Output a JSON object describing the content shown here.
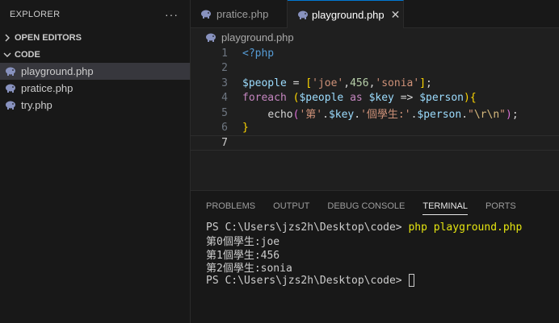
{
  "explorer": {
    "title": "EXPLORER",
    "more": "···",
    "open_editors": "OPEN EDITORS",
    "folder": "CODE",
    "files": [
      {
        "name": "playground.php"
      },
      {
        "name": "pratice.php"
      },
      {
        "name": "try.php"
      }
    ]
  },
  "tabs": [
    {
      "label": "pratice.php"
    },
    {
      "label": "playground.php",
      "close": "✕"
    }
  ],
  "breadcrumb": "playground.php",
  "code": {
    "line_numbers": [
      "1",
      "2",
      "3",
      "4",
      "5",
      "6",
      "7"
    ],
    "l1": "<?php",
    "l3": {
      "var": "$people",
      "eq": " = ",
      "ob": "[",
      "s1": "'joe'",
      "c1": ",",
      "n1": "456",
      "c2": ",",
      "s2": "'sonia'",
      "cb": "]",
      "end": ";"
    },
    "l4": {
      "kw": "foreach",
      "sp": " ",
      "op": "(",
      "v1": "$people",
      "as": " as ",
      "v2": "$key",
      "arrow": " => ",
      "v3": "$person",
      "cp": ")",
      "ob": "{"
    },
    "l5": {
      "indent": "    ",
      "fn": "echo",
      "op": "(",
      "s1": "'第'",
      "d1": ".",
      "v1": "$key",
      "d2": ".",
      "s2": "'個學生:'",
      "d3": ".",
      "v2": "$person",
      "d4": ".",
      "q1": "\"",
      "esc": "\\r\\n",
      "q2": "\"",
      "cp": ")",
      "end": ";"
    },
    "l6": "}"
  },
  "panel": {
    "tabs": [
      "PROBLEMS",
      "OUTPUT",
      "DEBUG CONSOLE",
      "TERMINAL",
      "PORTS"
    ],
    "active_tab": "TERMINAL"
  },
  "terminal": {
    "prompt1": "PS C:\\Users\\jzs2h\\Desktop\\code> ",
    "command": "php playground.php",
    "out1": "第0個學生:joe",
    "out2": "第1個學生:456",
    "out3": "第2個學生:sonia",
    "prompt2": "PS C:\\Users\\jzs2h\\Desktop\\code> "
  },
  "colors": {
    "php_icon": "#8892bf",
    "accent": "#0078d4"
  }
}
